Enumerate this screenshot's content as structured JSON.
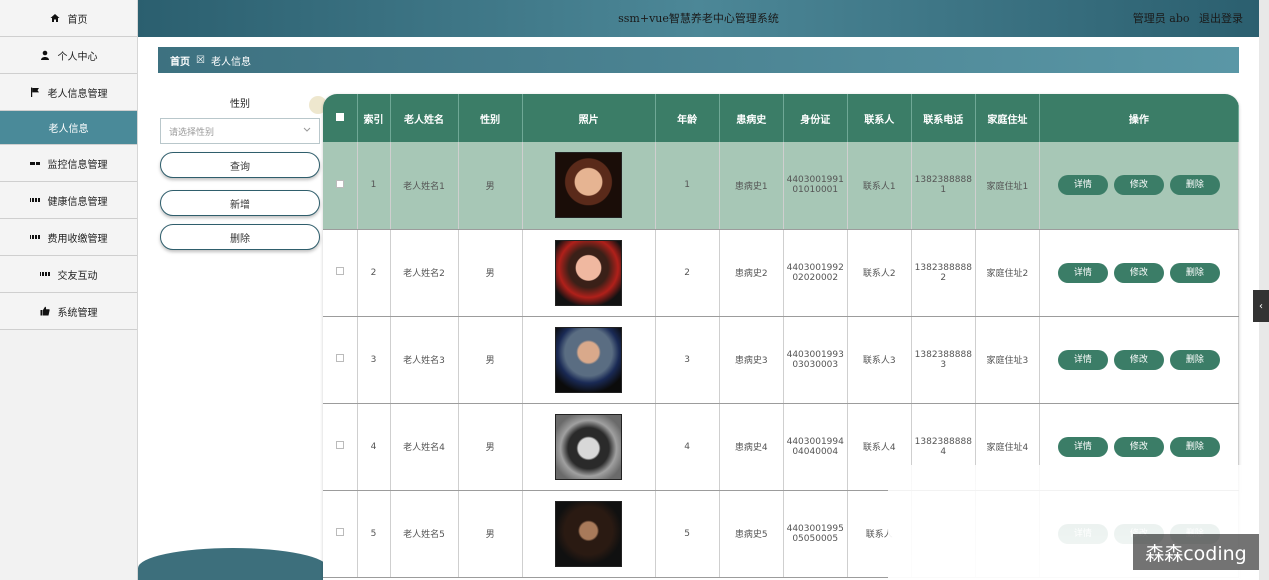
{
  "sidebar": {
    "items": [
      {
        "label": "首页",
        "icon": "home-icon"
      },
      {
        "label": "个人中心",
        "icon": "user-icon"
      },
      {
        "label": "老人信息管理",
        "icon": "flag-icon"
      },
      {
        "label": "老人信息",
        "icon": ""
      },
      {
        "label": "监控信息管理",
        "icon": "grid-icon"
      },
      {
        "label": "健康信息管理",
        "icon": "grid-icon"
      },
      {
        "label": "费用收缴管理",
        "icon": "grid-icon"
      },
      {
        "label": "交友互动",
        "icon": "grid-icon"
      },
      {
        "label": "系统管理",
        "icon": "thumbs-up-icon"
      }
    ]
  },
  "header": {
    "title": "ssm+vue智慧养老中心管理系统",
    "user": "管理员 abo",
    "logout": "退出登录"
  },
  "breadcrumb": {
    "home": "首页",
    "sep": "☒",
    "current": "老人信息"
  },
  "search": {
    "gender_label": "性别",
    "gender_placeholder": "请选择性别",
    "query_button": "查询",
    "add_button": "新增",
    "delete_button": "删除"
  },
  "table": {
    "headers": [
      "索引",
      "老人姓名",
      "性别",
      "照片",
      "年龄",
      "患病史",
      "身份证",
      "联系人",
      "联系电话",
      "家庭住址",
      "操作"
    ],
    "actions": [
      "详情",
      "修改",
      "删除"
    ],
    "rows": [
      {
        "index": "1",
        "name": "老人姓名1",
        "gender": "男",
        "age": "1",
        "history": "患病史1",
        "id_a": "4403001991",
        "id_b": "01010001",
        "contact": "联系人1",
        "phone_a": "1382388888",
        "phone_b": "1",
        "address": "家庭住址1"
      },
      {
        "index": "2",
        "name": "老人姓名2",
        "gender": "男",
        "age": "2",
        "history": "患病史2",
        "id_a": "4403001992",
        "id_b": "02020002",
        "contact": "联系人2",
        "phone_a": "1382388888",
        "phone_b": "2",
        "address": "家庭住址2"
      },
      {
        "index": "3",
        "name": "老人姓名3",
        "gender": "男",
        "age": "3",
        "history": "患病史3",
        "id_a": "4403001993",
        "id_b": "03030003",
        "contact": "联系人3",
        "phone_a": "1382388888",
        "phone_b": "3",
        "address": "家庭住址3"
      },
      {
        "index": "4",
        "name": "老人姓名4",
        "gender": "男",
        "age": "4",
        "history": "患病史4",
        "id_a": "4403001994",
        "id_b": "04040004",
        "contact": "联系人4",
        "phone_a": "1382388888",
        "phone_b": "4",
        "address": "家庭住址4"
      },
      {
        "index": "5",
        "name": "老人姓名5",
        "gender": "男",
        "age": "5",
        "history": "患病史5",
        "id_a": "4403001995",
        "id_b": "05050005",
        "contact": "联系人",
        "phone_a": "",
        "phone_b": "",
        "address": ""
      }
    ]
  },
  "watermark": "森森coding",
  "colors": {
    "accent": "#3b7d67",
    "header": "#2b5f6f",
    "highlight_row": "#a7c7b6"
  }
}
